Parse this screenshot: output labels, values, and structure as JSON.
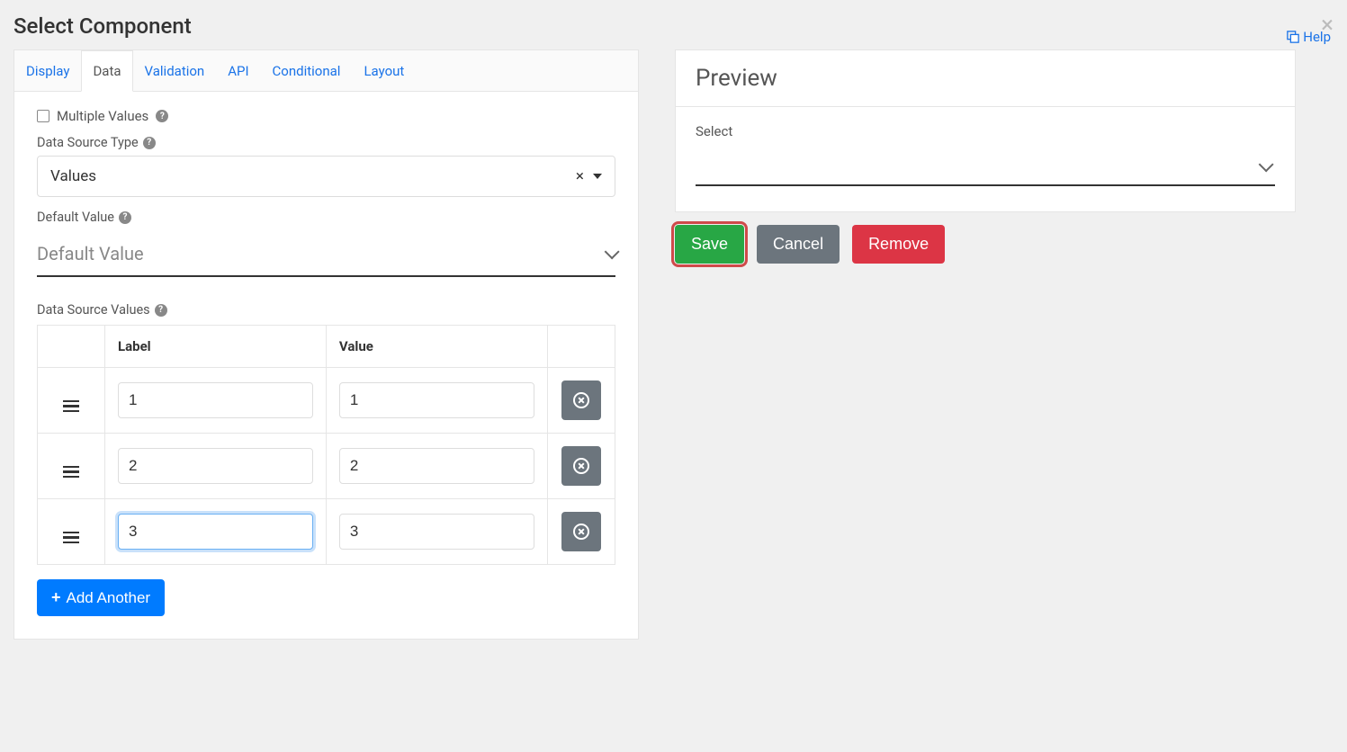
{
  "title": "Select Component",
  "help_text": "Help",
  "tabs": [
    "Display",
    "Data",
    "Validation",
    "API",
    "Conditional",
    "Layout"
  ],
  "active_tab_index": 1,
  "multiple_values": {
    "label": "Multiple Values",
    "checked": false
  },
  "data_source_type": {
    "label": "Data Source Type",
    "value": "Values"
  },
  "default_value": {
    "label": "Default Value",
    "placeholder": "Default Value"
  },
  "data_source_values": {
    "label": "Data Source Values",
    "columns": {
      "label": "Label",
      "value": "Value"
    },
    "rows": [
      {
        "label": "1",
        "value": "1"
      },
      {
        "label": "2",
        "value": "2"
      },
      {
        "label": "3",
        "value": "3"
      }
    ],
    "focused_row": 2,
    "focused_col": "label"
  },
  "add_another_label": "Add Another",
  "preview": {
    "title": "Preview",
    "field_label": "Select"
  },
  "buttons": {
    "save": "Save",
    "cancel": "Cancel",
    "remove": "Remove"
  }
}
